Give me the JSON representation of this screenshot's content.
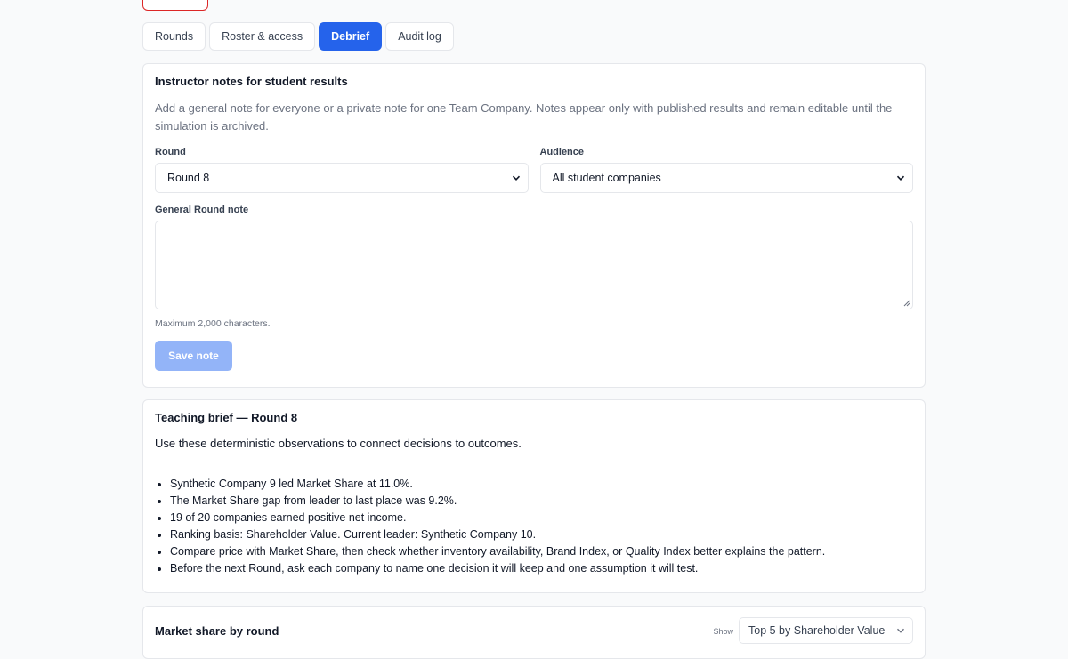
{
  "tabs": [
    {
      "label": "Rounds",
      "active": false
    },
    {
      "label": "Roster & access",
      "active": false
    },
    {
      "label": "Debrief",
      "active": true
    },
    {
      "label": "Audit log",
      "active": false
    }
  ],
  "notes": {
    "title": "Instructor notes for student results",
    "description": "Add a general note for everyone or a private note for one Team Company. Notes appear only with published results and remain editable until the simulation is archived.",
    "round_label": "Round",
    "round_value": "Round 8",
    "audience_label": "Audience",
    "audience_value": "All student companies",
    "note_label": "General Round note",
    "note_value": "",
    "hint": "Maximum 2,000 characters.",
    "save_label": "Save note"
  },
  "brief": {
    "title": "Teaching brief — Round 8",
    "intro": "Use these deterministic observations to connect decisions to outcomes.",
    "items": [
      "Synthetic Company 9 led Market Share at 11.0%.",
      "The Market Share gap from leader to last place was 9.2%.",
      "19 of 20 companies earned positive net income.",
      "Ranking basis: Shareholder Value. Current leader: Synthetic Company 10.",
      "Compare price with Market Share, then check whether inventory availability, Brand Index, or Quality Index better explains the pattern.",
      "Before the next Round, ask each company to name one decision it will keep and one assumption it will test."
    ]
  },
  "chart": {
    "title": "Market share by round",
    "show_label": "Show",
    "show_value": "Top 5 by Shareholder Value"
  },
  "colors": {
    "accent": "#2563eb",
    "danger": "#dc2626",
    "save_disabled": "#93b4f8"
  }
}
